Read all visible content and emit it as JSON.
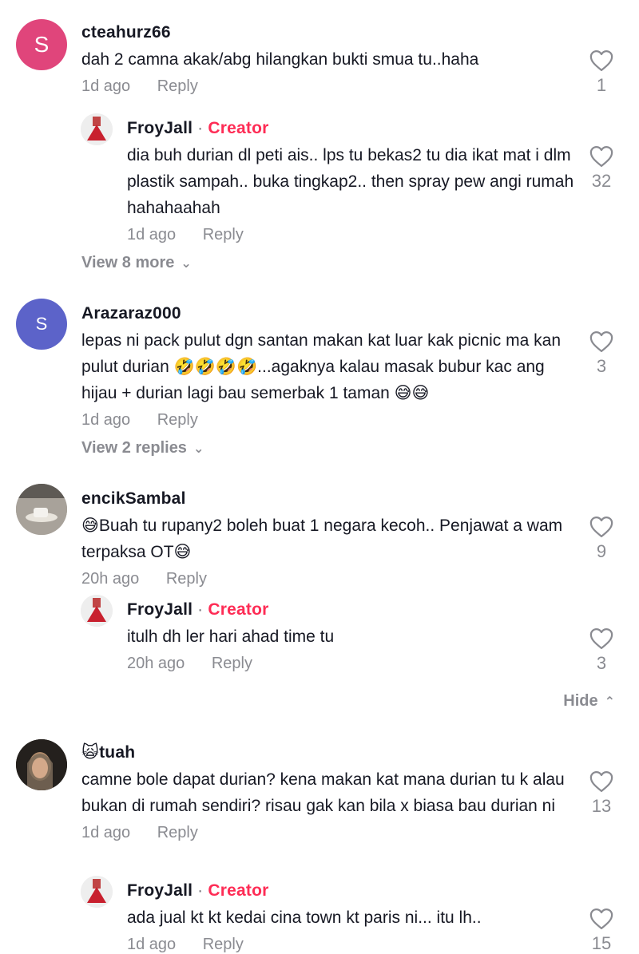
{
  "comments": [
    {
      "avatar_letter": "S",
      "avatar_color": "#e0457b",
      "username": "cteahurz66",
      "text": "dah 2 camna akak/abg hilangkan bukti smua tu..haha",
      "time": "1d ago",
      "reply_label": "Reply",
      "likes": "1"
    },
    {
      "username": "FroyJall",
      "separator": " · ",
      "creator_label": "Creator",
      "text": "dia buh durian dl peti ais.. lps tu bekas2 tu dia ikat mat i dlm plastik sampah.. buka tingkap2.. then spray pew angi rumah hahahaahah",
      "time": "1d ago",
      "reply_label": "Reply",
      "likes": "32"
    },
    {
      "avatar_letter": "S",
      "avatar_color": "#5c63c9",
      "username": "Arazaraz000",
      "text": "lepas ni pack pulut dgn santan makan kat luar kak picnic ma kan pulut durian 🤣🤣🤣🤣...agaknya kalau masak bubur kac ang hijau + durian lagi bau semerbak 1 taman 😅😅",
      "time": "1d ago",
      "reply_label": "Reply",
      "likes": "3"
    },
    {
      "username": "encikSambal",
      "text": "😅Buah tu rupany2 boleh buat 1 negara kecoh.. Penjawat a wam terpaksa OT😅",
      "time": "20h ago",
      "reply_label": "Reply",
      "likes": "9"
    },
    {
      "username": "FroyJall",
      "separator": " · ",
      "creator_label": "Creator",
      "text": "itulh dh ler hari ahad time tu",
      "time": "20h ago",
      "reply_label": "Reply",
      "likes": "3"
    },
    {
      "username": "🙀tuah",
      "text": "camne bole dapat durian? kena makan kat mana durian tu k alau bukan di rumah sendiri? risau gak kan bila x biasa bau durian ni",
      "time": "1d ago",
      "reply_label": "Reply",
      "likes": "13"
    },
    {
      "username": "FroyJall",
      "separator": " · ",
      "creator_label": "Creator",
      "text": "ada jual kt kt kedai cina town kt paris ni... itu lh..",
      "time": "1d ago",
      "reply_label": "Reply",
      "likes": "15"
    }
  ],
  "view_more_1": "View 8 more",
  "view_more_2": "View 2 replies",
  "hide_label": "Hide",
  "icons": {
    "like": "heart-outline-icon",
    "expand": "chevron-down-icon",
    "collapse": "chevron-up-icon"
  }
}
